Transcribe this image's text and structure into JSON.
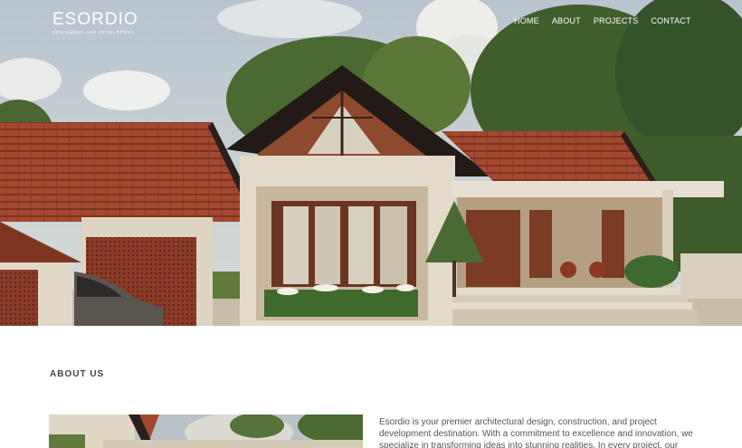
{
  "brand": {
    "name": "ESORDIO",
    "tagline": "DESIGNERS AND DEVELOPERS"
  },
  "nav": {
    "items": [
      "HOME",
      "ABOUT",
      "PROJECTS",
      "CONTACT"
    ]
  },
  "about": {
    "heading": "ABOUT US",
    "text": "Esordio is your premier architectural design, construction, and project development destination. With a commitment to excellence and innovation, we specialize in transforming ideas into stunning realities. In every project, our"
  },
  "colors": {
    "roof": "#a34a31",
    "wall": "#ddd2c0",
    "sky": "#c4cdd6",
    "trees": "#3f5e2c"
  }
}
